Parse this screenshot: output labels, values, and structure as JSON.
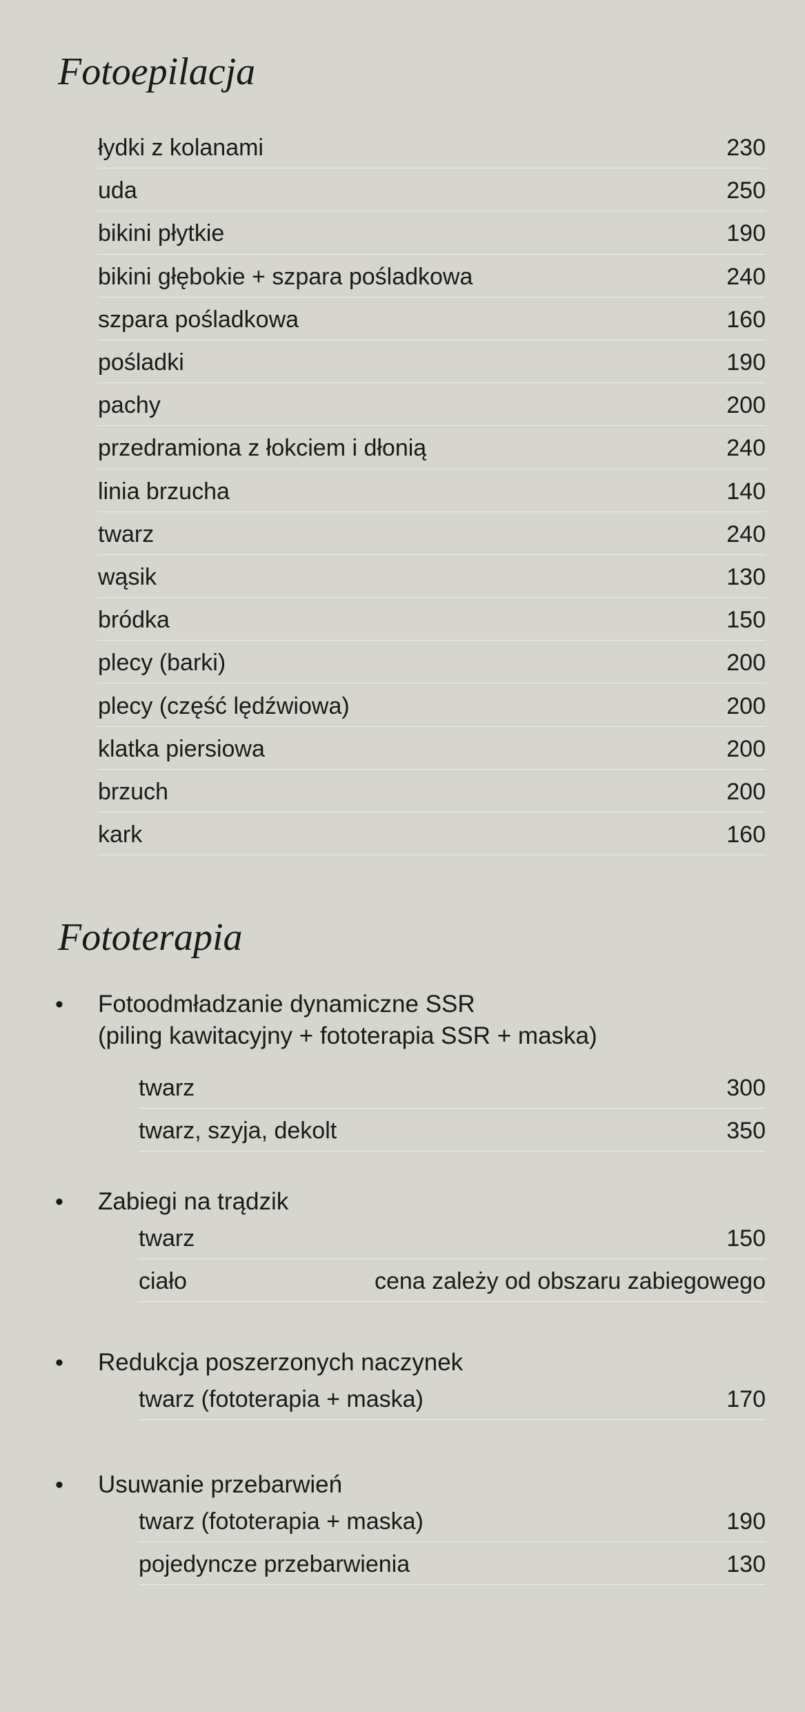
{
  "fotoepilacja": {
    "title": "Fotoepilacja",
    "items": [
      {
        "name": "łydki z kolanami",
        "price": "230"
      },
      {
        "name": "uda",
        "price": "250"
      },
      {
        "name": "bikini płytkie",
        "price": "190"
      },
      {
        "name": "bikini głębokie + szpara pośladkowa",
        "price": "240"
      },
      {
        "name": "szpara pośladkowa",
        "price": "160"
      },
      {
        "name": "pośladki",
        "price": "190"
      },
      {
        "name": "pachy",
        "price": "200"
      },
      {
        "name": "przedramiona z łokciem i dłonią",
        "price": "240"
      },
      {
        "name": "linia brzucha",
        "price": "140"
      },
      {
        "name": "twarz",
        "price": "240"
      },
      {
        "name": "wąsik",
        "price": "130"
      },
      {
        "name": "bródka",
        "price": "150"
      },
      {
        "name": "plecy (barki)",
        "price": "200"
      },
      {
        "name": "plecy (część lędźwiowa)",
        "price": "200"
      },
      {
        "name": "klatka piersiowa",
        "price": "200"
      },
      {
        "name": "brzuch",
        "price": "200"
      },
      {
        "name": "kark",
        "price": "160"
      }
    ]
  },
  "fototerapia": {
    "title": "Fototerapia",
    "bullet": "•",
    "groups": [
      {
        "title_line1": "Fotoodmładzanie dynamiczne SSR",
        "title_line2": "(piling kawitacyjny + fototerapia SSR + maska)",
        "items": [
          {
            "name": "twarz",
            "price": "300"
          },
          {
            "name": "twarz, szyja, dekolt",
            "price": "350"
          }
        ]
      },
      {
        "title_line1": "Zabiegi na trądzik",
        "items": [
          {
            "name": "twarz",
            "price": "150"
          },
          {
            "name": "ciało",
            "price": "cena zależy od obszaru zabiegowego"
          }
        ]
      },
      {
        "title_line1": "Redukcja poszerzonych naczynek",
        "items": [
          {
            "name": "twarz (fototerapia + maska)",
            "price": "170"
          }
        ]
      },
      {
        "title_line1": "Usuwanie przebarwień",
        "items": [
          {
            "name": "twarz (fototerapia + maska)",
            "price": "190"
          },
          {
            "name": "pojedyncze przebarwienia",
            "price": "130"
          }
        ]
      }
    ]
  }
}
